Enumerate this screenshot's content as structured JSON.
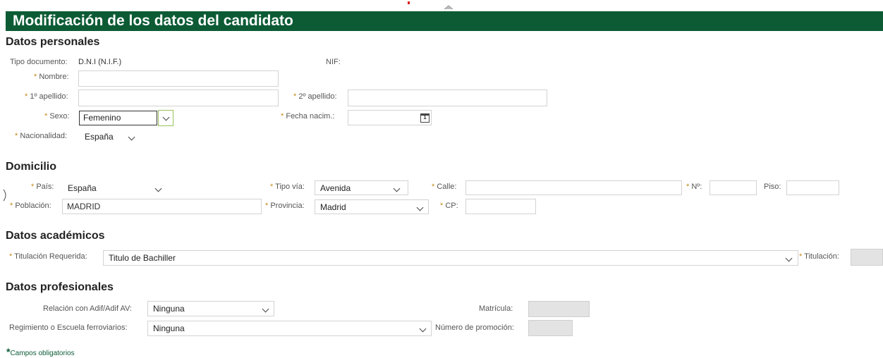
{
  "header": {
    "title": "Modificación de los datos del candidato"
  },
  "personal": {
    "section_title": "Datos personales",
    "tipo_documento_label": "Tipo documento:",
    "tipo_documento_value": "D.N.I (N.I.F.)",
    "nif_label": "NIF:",
    "nombre_label": "Nombre:",
    "apellido1_label": "1º apellido:",
    "apellido2_label": "2º apellido:",
    "sexo_label": "Sexo:",
    "sexo_value": "Femenino",
    "fecha_label": "Fecha nacim.:",
    "nacionalidad_label": "Nacionalidad:",
    "nacionalidad_value": "España"
  },
  "domicilio": {
    "section_title": "Domicilio",
    "pais_label": "País:",
    "pais_value": "España",
    "tipo_via_label": "Tipo vía:",
    "tipo_via_value": "Avenida",
    "calle_label": "Calle:",
    "numero_label": "Nº:",
    "piso_label": "Piso:",
    "poblacion_label": "Población:",
    "poblacion_value": "MADRID",
    "provincia_label": "Provincia:",
    "provincia_value": "Madrid",
    "cp_label": "CP:"
  },
  "academicos": {
    "section_title": "Datos académicos",
    "titulacion_requerida_label": "Titulación Requerida:",
    "titulacion_requerida_value": "Titulo de Bachiller",
    "titulacion_label": "Titulación:"
  },
  "profesionales": {
    "section_title": "Datos profesionales",
    "relacion_label": "Relación con Adif/Adif AV:",
    "relacion_value": "Ninguna",
    "matricula_label": "Matrícula:",
    "regimiento_label": "Regimiento o Escuela ferroviarios:",
    "regimiento_value": "Ninguna",
    "promocion_label": "Número de promoción:"
  },
  "footer": {
    "required_star": "*",
    "required_note": "Campos obligatorios"
  },
  "colors": {
    "header_bg": "#0c5b35",
    "required_mark": "#c48a1a"
  }
}
